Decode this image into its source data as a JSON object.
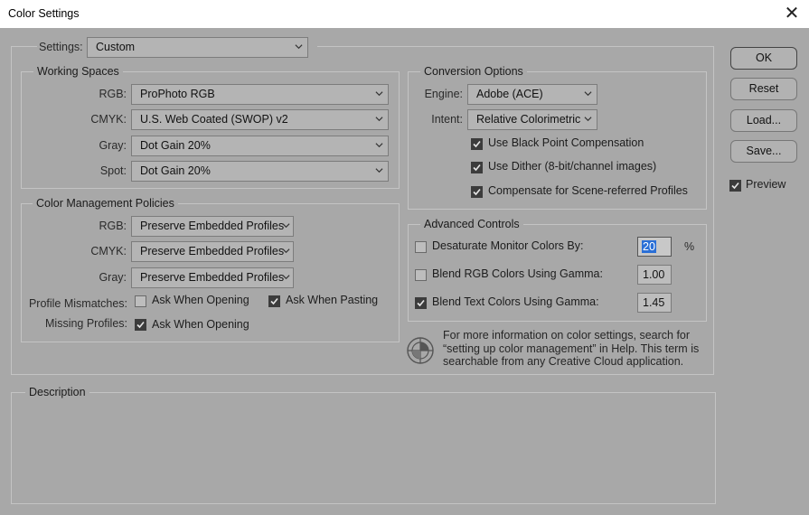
{
  "window": {
    "title": "Color Settings",
    "close_glyph": "✕"
  },
  "settings": {
    "label": "Settings:",
    "value": "Custom"
  },
  "working_spaces": {
    "legend": "Working Spaces",
    "rows": [
      {
        "label": "RGB:",
        "value": "ProPhoto RGB"
      },
      {
        "label": "CMYK:",
        "value": "U.S. Web Coated (SWOP) v2"
      },
      {
        "label": "Gray:",
        "value": "Dot Gain 20%"
      },
      {
        "label": "Spot:",
        "value": "Dot Gain 20%"
      }
    ]
  },
  "policies": {
    "legend": "Color Management Policies",
    "rows": [
      {
        "label": "RGB:",
        "value": "Preserve Embedded Profiles"
      },
      {
        "label": "CMYK:",
        "value": "Preserve Embedded Profiles"
      },
      {
        "label": "Gray:",
        "value": "Preserve Embedded Profiles"
      }
    ],
    "mismatch_label": "Profile Mismatches:",
    "mismatch_open": {
      "label": "Ask When Opening",
      "checked": false
    },
    "mismatch_paste": {
      "label": "Ask When Pasting",
      "checked": true
    },
    "missing_label": "Missing Profiles:",
    "missing_open": {
      "label": "Ask When Opening",
      "checked": true
    }
  },
  "conversion": {
    "legend": "Conversion Options",
    "engine_label": "Engine:",
    "engine_value": "Adobe (ACE)",
    "intent_label": "Intent:",
    "intent_value": "Relative Colorimetric",
    "black_point": {
      "label": "Use Black Point Compensation",
      "checked": true
    },
    "dither": {
      "label": "Use Dither (8-bit/channel images)",
      "checked": true
    },
    "scene": {
      "label": "Compensate for Scene-referred Profiles",
      "checked": true
    }
  },
  "advanced": {
    "legend": "Advanced Controls",
    "desaturate": {
      "label": "Desaturate Monitor Colors By:",
      "checked": false,
      "value": "20",
      "unit": "%"
    },
    "blend_rgb": {
      "label": "Blend RGB Colors Using Gamma:",
      "checked": false,
      "value": "1.00"
    },
    "blend_text": {
      "label": "Blend Text Colors Using Gamma:",
      "checked": true,
      "value": "1.45"
    }
  },
  "info_text": "For more information on color settings, search for “setting up color management” in Help. This term is searchable from any Creative Cloud application.",
  "description": {
    "legend": "Description"
  },
  "buttons": {
    "ok": "OK",
    "reset": "Reset",
    "load": "Load...",
    "save": "Save..."
  },
  "preview": {
    "label": "Preview",
    "checked": true
  },
  "icons": [
    "close-icon",
    "chevron-down-icon",
    "checkmark-icon",
    "color-wheel-icon"
  ]
}
